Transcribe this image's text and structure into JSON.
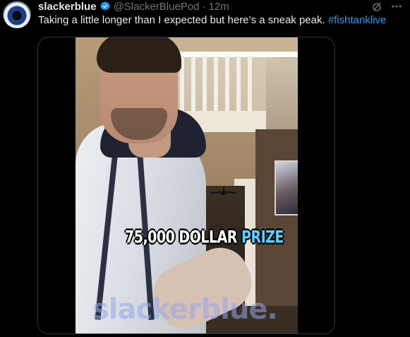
{
  "post": {
    "display_name": "slackerblue",
    "handle": "@SlackerBluePod",
    "separator": "·",
    "timestamp": "12m",
    "text_main": "Taking a little longer than I expected but here’s a sneak peak. ",
    "hashtag": "#fishtanklive"
  },
  "media": {
    "caption_main": "75,000 DOLLAR ",
    "caption_highlight": "PRIZE",
    "watermark": "slackerblue."
  },
  "icons": {
    "verified": "verified-badge-icon",
    "grok": "grok-icon",
    "more": "more-icon"
  },
  "colors": {
    "accent": "#1d9bf0",
    "text": "#e7e9ea",
    "muted": "#71767b",
    "caption_highlight": "#5ad1ff"
  }
}
